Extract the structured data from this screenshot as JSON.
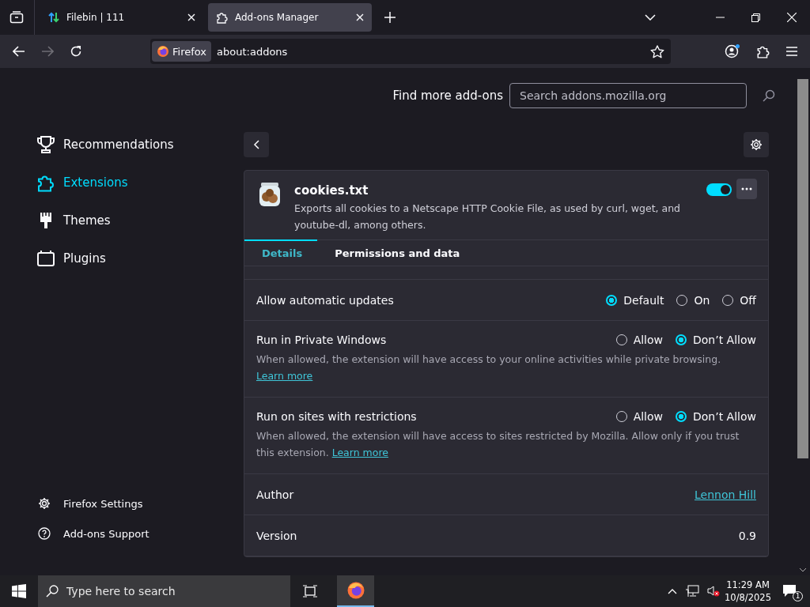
{
  "tabs": [
    {
      "kind": "filebin",
      "title": "Filebin | 111",
      "selected": false
    },
    {
      "kind": "addon",
      "title": "Add-ons Manager",
      "selected": true
    }
  ],
  "address": {
    "identity": "Firefox",
    "url": "about:addons"
  },
  "header": {
    "find_label": "Find more add-ons",
    "search_placeholder": "Search addons.mozilla.org"
  },
  "sidebar": {
    "categories": [
      {
        "kind": "trophy",
        "label": "Recommendations",
        "selected": false
      },
      {
        "kind": "puzzle",
        "label": "Extensions",
        "selected": true
      },
      {
        "kind": "brush",
        "label": "Themes",
        "selected": false
      },
      {
        "kind": "plugin",
        "label": "Plugins",
        "selected": false
      }
    ],
    "footer": [
      {
        "kind": "gear",
        "label": "Firefox Settings"
      },
      {
        "kind": "help",
        "label": "Add-ons Support"
      }
    ]
  },
  "addon": {
    "name": "cookies.txt",
    "description": "Exports all cookies to a Netscape HTTP Cookie File, as used by curl, wget, and youtube-dl, among others.",
    "enabled": true
  },
  "detail_tabs": [
    {
      "label": "Details",
      "selected": true
    },
    {
      "label": "Permissions and data",
      "selected": false
    }
  ],
  "rows": [
    {
      "kind": "radio",
      "label": "Allow automatic updates",
      "options": [
        {
          "label": "Default",
          "selected": true
        },
        {
          "label": "On",
          "selected": false
        },
        {
          "label": "Off",
          "selected": false
        }
      ]
    },
    {
      "kind": "radio",
      "label": "Run in Private Windows",
      "options": [
        {
          "label": "Allow",
          "selected": false
        },
        {
          "label": "Don’t Allow",
          "selected": true
        }
      ],
      "description": "When allowed, the extension will have access to your online activities while private browsing.",
      "learn_more": "Learn more"
    },
    {
      "kind": "radio",
      "label": "Run on sites with restrictions",
      "options": [
        {
          "label": "Allow",
          "selected": false
        },
        {
          "label": "Don’t Allow",
          "selected": true
        }
      ],
      "description": "When allowed, the extension will have access to sites restricted by Mozilla. Allow only if you trust this extension.",
      "learn_more": "Learn more"
    },
    {
      "kind": "link",
      "label": "Author",
      "value": "Lennon Hill"
    },
    {
      "kind": "text",
      "label": "Version",
      "value": "0.9"
    }
  ],
  "taskbar": {
    "search_placeholder": "Type here to search",
    "time": "11:29 AM",
    "date": "10/8/2025",
    "notifications": "1"
  }
}
